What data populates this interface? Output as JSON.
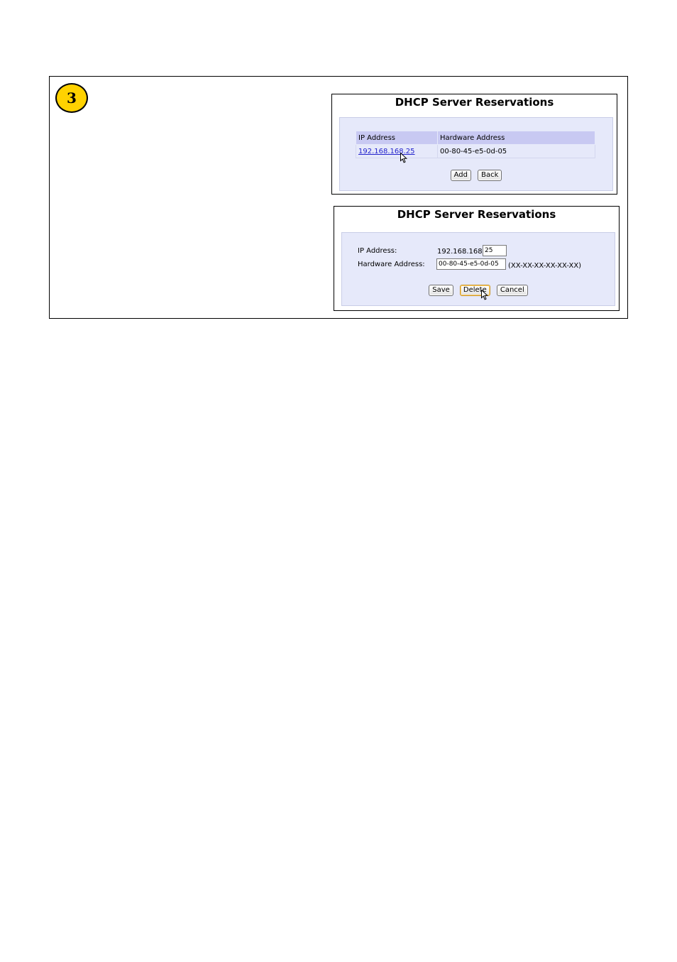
{
  "step": {
    "number": "3"
  },
  "reservations_list": {
    "title": "DHCP Server Reservations",
    "columns": [
      "IP Address",
      "Hardware Address"
    ],
    "rows": [
      {
        "ip": "192.168.168.25",
        "mac": "00-80-45-e5-0d-05"
      }
    ],
    "buttons": {
      "add": "Add",
      "back": "Back"
    }
  },
  "reservation_edit": {
    "title": "DHCP Server Reservations",
    "ip_label": "IP Address:",
    "ip_prefix": "192.168.168.",
    "ip_value": "25",
    "hw_label": "Hardware Address:",
    "hw_value": "00-80-45-e5-0d-05",
    "hw_hint": "(XX-XX-XX-XX-XX-XX)",
    "buttons": {
      "save": "Save",
      "delete": "Delete",
      "cancel": "Cancel"
    }
  },
  "colors": {
    "badge": "#ffd200",
    "panel_bg": "#e6e9fa",
    "header_bg": "#c8c9f2",
    "link": "#2222cc"
  }
}
